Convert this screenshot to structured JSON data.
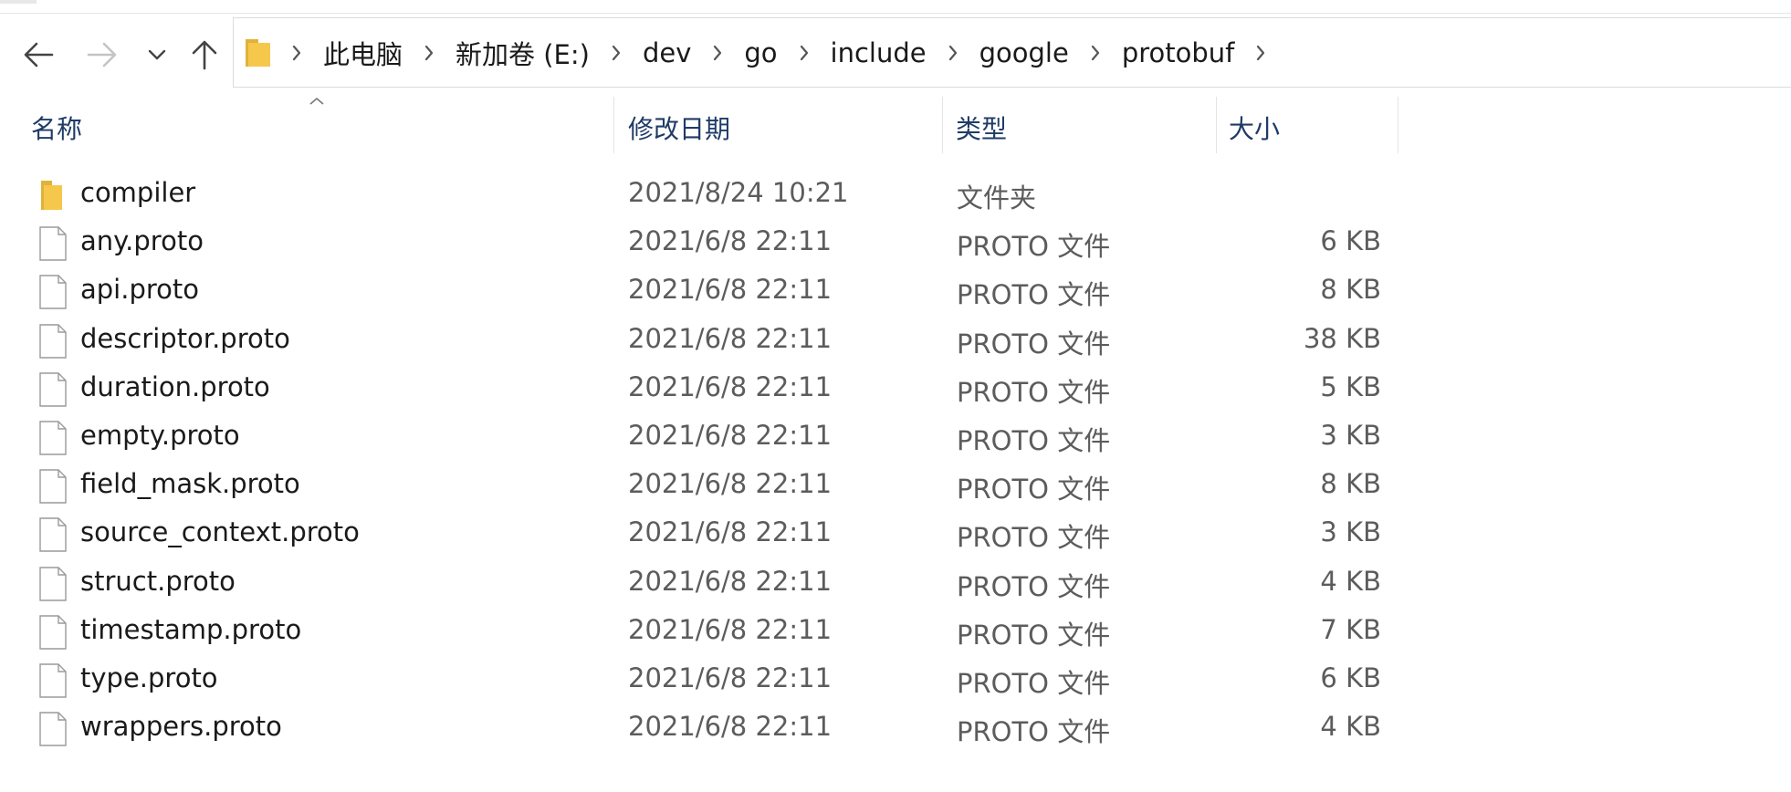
{
  "nav": {
    "back": "back-arrow",
    "forward": "forward-arrow",
    "recent": "chevron-down",
    "up": "up-arrow"
  },
  "breadcrumbs": [
    "此电脑",
    "新加卷 (E:)",
    "dev",
    "go",
    "include",
    "google",
    "protobuf"
  ],
  "columns": {
    "name": "名称",
    "date": "修改日期",
    "type": "类型",
    "size": "大小"
  },
  "files": [
    {
      "name": "compiler",
      "date": "2021/8/24 10:21",
      "type": "文件夹",
      "size": "",
      "icon": "folder"
    },
    {
      "name": "any.proto",
      "date": "2021/6/8 22:11",
      "type": "PROTO 文件",
      "size": "6 KB",
      "icon": "file"
    },
    {
      "name": "api.proto",
      "date": "2021/6/8 22:11",
      "type": "PROTO 文件",
      "size": "8 KB",
      "icon": "file"
    },
    {
      "name": "descriptor.proto",
      "date": "2021/6/8 22:11",
      "type": "PROTO 文件",
      "size": "38 KB",
      "icon": "file"
    },
    {
      "name": "duration.proto",
      "date": "2021/6/8 22:11",
      "type": "PROTO 文件",
      "size": "5 KB",
      "icon": "file"
    },
    {
      "name": "empty.proto",
      "date": "2021/6/8 22:11",
      "type": "PROTO 文件",
      "size": "3 KB",
      "icon": "file"
    },
    {
      "name": "field_mask.proto",
      "date": "2021/6/8 22:11",
      "type": "PROTO 文件",
      "size": "8 KB",
      "icon": "file"
    },
    {
      "name": "source_context.proto",
      "date": "2021/6/8 22:11",
      "type": "PROTO 文件",
      "size": "3 KB",
      "icon": "file"
    },
    {
      "name": "struct.proto",
      "date": "2021/6/8 22:11",
      "type": "PROTO 文件",
      "size": "4 KB",
      "icon": "file"
    },
    {
      "name": "timestamp.proto",
      "date": "2021/6/8 22:11",
      "type": "PROTO 文件",
      "size": "7 KB",
      "icon": "file"
    },
    {
      "name": "type.proto",
      "date": "2021/6/8 22:11",
      "type": "PROTO 文件",
      "size": "6 KB",
      "icon": "file"
    },
    {
      "name": "wrappers.proto",
      "date": "2021/6/8 22:11",
      "type": "PROTO 文件",
      "size": "4 KB",
      "icon": "file"
    }
  ],
  "colors": {
    "header_text": "#1f3b66",
    "folder": "#f5c84c",
    "disabled": "#c4c4c4"
  }
}
